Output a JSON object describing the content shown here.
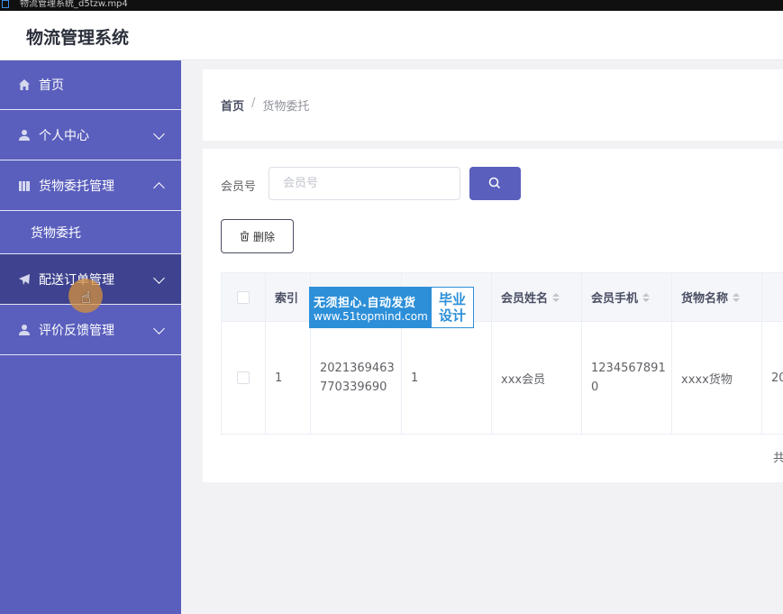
{
  "titlebar": {
    "text": "物流管理系统_d5tzw.mp4"
  },
  "header": {
    "title": "物流管理系统"
  },
  "sidebar": {
    "items": [
      {
        "label": "首页",
        "icon": "home-icon"
      },
      {
        "label": "个人中心",
        "icon": "user-icon"
      },
      {
        "label": "货物委托管理",
        "icon": "document-icon",
        "expanded": true
      },
      {
        "label": "配送订单管理",
        "icon": "send-icon"
      },
      {
        "label": "评价反馈管理",
        "icon": "user-icon"
      }
    ],
    "submenu": [
      {
        "label": "货物委托"
      }
    ]
  },
  "breadcrumb": {
    "home": "首页",
    "separator": "/",
    "current": "货物委托"
  },
  "search": {
    "label": "会员号",
    "placeholder": "会员号"
  },
  "toolbar": {
    "delete_label": "删除"
  },
  "table": {
    "headers": [
      "索引",
      "",
      "",
      "会员姓名",
      "会员手机",
      "货物名称",
      ""
    ],
    "rows": [
      [
        "1",
        "2021369463770339690",
        "1",
        "xxx会员",
        "12345678910",
        "xxxx货物",
        "20"
      ]
    ]
  },
  "watermark": {
    "line1": "无须担心.自动发货",
    "line2": "www.51topmind.com",
    "badge_line1": "毕业",
    "badge_line2": "设计"
  },
  "pager": {
    "text": "共"
  },
  "colors": {
    "sidebar": "#5a5fbd",
    "sidebar_active": "#3f438f",
    "primary": "#5a5fbd"
  }
}
